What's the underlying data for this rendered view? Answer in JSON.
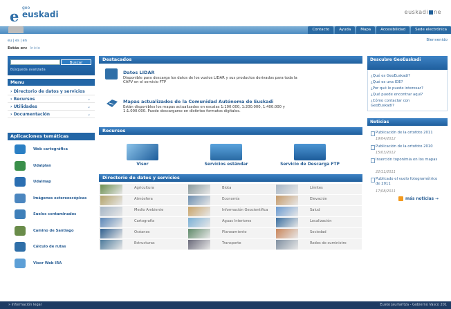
{
  "header": {
    "logo_small": "geo",
    "logo_main": "euskadi",
    "logo_letter": "e",
    "brand_right": "euskadi",
    "brand_right_suffix": "ne"
  },
  "nav": {
    "links": [
      "Contacto",
      "Ayuda",
      "Mapa",
      "Accesibilidad",
      "Sede electrónica"
    ]
  },
  "lang": "eu | es | en",
  "welcome": "Bienvenido",
  "breadcrumb": {
    "label": "Estás en:",
    "home": "Inicio"
  },
  "search": {
    "button": "Buscar",
    "advanced": "Búsqueda avanzada"
  },
  "menu": {
    "title": "Menu",
    "items": [
      {
        "label": "Directorio de datos y servicios"
      },
      {
        "label": "Recursos"
      },
      {
        "label": "Utilidades"
      },
      {
        "label": "Documentación"
      }
    ]
  },
  "apps": {
    "title": "Aplicaciones temáticas",
    "items": [
      {
        "label": "Web cartográfica",
        "color": "#2a7fc4"
      },
      {
        "label": "Udalplan",
        "color": "#3a8f4a"
      },
      {
        "label": "Udalmap",
        "color": "#2b6fb2"
      },
      {
        "label": "Imágenes estereoscópicas",
        "color": "#4b86bf"
      },
      {
        "label": "Suelos contaminados",
        "color": "#3e7fb9"
      },
      {
        "label": "Camino de Santiago",
        "color": "#6a8c4a"
      },
      {
        "label": "Cálculo de rutas",
        "color": "#2f6fa8"
      },
      {
        "label": "Visor Web IRA",
        "color": "#5d9fd6"
      }
    ]
  },
  "destacados": {
    "title": "Destacados",
    "items": [
      {
        "title": "Datos LIDAR",
        "desc1": "Disponible para descarga los datos de los vuelos LIDAR y sus productos derivados para toda la",
        "desc2": "CAPV en el servicio FTP"
      },
      {
        "title": "Mapas actualizados de la Comunidad Autónoma de Euskadi",
        "desc1": "Están disponibles los mapas actualizados en escalas 1:100.000, 1:200.000, 1:400.000 y",
        "desc2": "1:1.000.000. Puede descargarse en distintos formatos digitales."
      }
    ]
  },
  "recursos": {
    "title": "Recursos",
    "items": [
      {
        "label": "Visor"
      },
      {
        "label": "Servicios estándar"
      },
      {
        "label": "Servicio de Descarga FTP"
      }
    ]
  },
  "directorio": {
    "title": "Directorio de datos y servicios",
    "rows": [
      [
        "Agricultura",
        "Biota",
        "Límites"
      ],
      [
        "Atmósfera",
        "Economía",
        "Elevación"
      ],
      [
        "Medio Ambiente",
        "Información Geocientífica",
        "Salud"
      ],
      [
        "Cartografía",
        "Aguas Interiores",
        "Localización"
      ],
      [
        "Océanos",
        "Planeamiento",
        "Sociedad"
      ],
      [
        "Estructuras",
        "Transporte",
        "Redes de suministro"
      ]
    ]
  },
  "descubre": {
    "title": "Descubre GeoEuskadi",
    "links": [
      "¿Qué es GeoEuskadi?",
      "¿Qué es una IDE?",
      "¿Por qué le puede interesar?",
      "¿Qué puede encontrar aquí?",
      "¿Cómo contactar con GeoEuskadi?"
    ]
  },
  "noticias": {
    "title": "Noticias",
    "items": [
      {
        "title": "Publicación de la ortofoto 2011",
        "date": "19/04/2012"
      },
      {
        "title": "Publicación de la ortofoto 2010",
        "date": "15/03/2012"
      },
      {
        "title": "Inserción toponimia en los mapas",
        "date": "22/11/2011"
      },
      {
        "title": "Publicado el vuelo fotogramétrico de 2011",
        "date": "17/08/2011"
      }
    ],
    "more": "más noticias"
  },
  "footer": {
    "left": "Información legal",
    "right": "Eusko Jaurlaritza - Gobierno Vasco 201"
  }
}
